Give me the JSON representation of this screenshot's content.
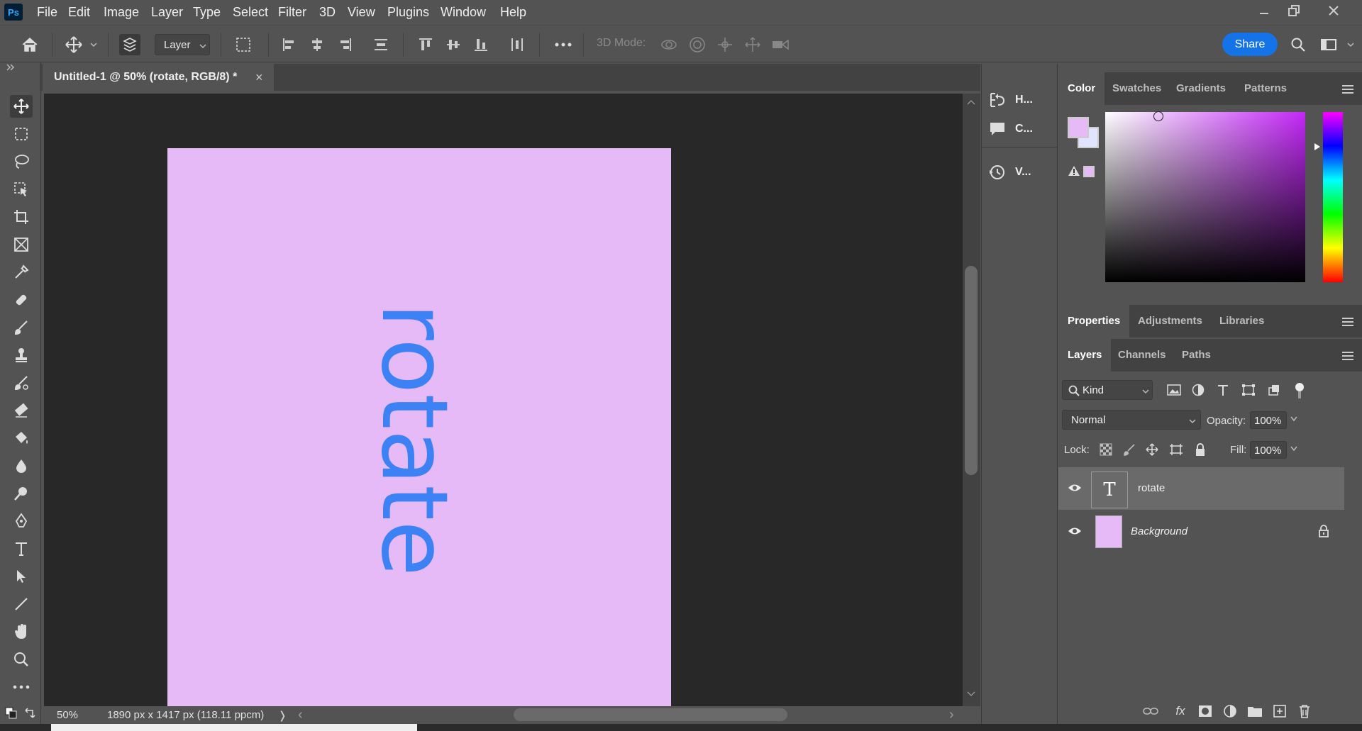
{
  "app": {
    "logo": "Ps"
  },
  "menu": [
    "File",
    "Edit",
    "Image",
    "Layer",
    "Type",
    "Select",
    "Filter",
    "3D",
    "View",
    "Plugins",
    "Window",
    "Help"
  ],
  "options": {
    "layer_select": "Layer",
    "mode_label": "3D Mode:",
    "share_label": "Share"
  },
  "document": {
    "tab_title": "Untitled-1 @ 50% (rotate, RGB/8) *",
    "close_glyph": "×",
    "canvas_text": "rotate",
    "canvas_color": "#e6b9f7",
    "text_color": "#3d82f5"
  },
  "status": {
    "zoom": "50%",
    "info": "1890 px x 1417 px (118.11 ppcm)",
    "arrow": "❭",
    "scroll_left": "‹",
    "scroll_right": "›"
  },
  "mid_panel": [
    {
      "icon": "history-brush-icon",
      "label": "H..."
    },
    {
      "icon": "comment-icon",
      "label": "C..."
    },
    {
      "icon": "history-icon",
      "label": "V..."
    }
  ],
  "color_panel": {
    "tabs": [
      "Color",
      "Swatches",
      "Gradients",
      "Patterns"
    ],
    "foreground": "#e6b9f7",
    "background": "#e0e4ff"
  },
  "properties_panel": {
    "tabs": [
      "Properties",
      "Adjustments",
      "Libraries"
    ]
  },
  "layers_panel": {
    "tabs": [
      "Layers",
      "Channels",
      "Paths"
    ],
    "filter_kind": "Kind",
    "blend_mode": "Normal",
    "opacity_label": "Opacity:",
    "opacity": "100%",
    "lock_label": "Lock:",
    "fill_label": "Fill:",
    "fill": "100%",
    "layers": [
      {
        "name": "rotate",
        "type": "text",
        "thumb_glyph": "T",
        "selected": true
      },
      {
        "name": "Background",
        "type": "pixel",
        "locked": true,
        "thumb_color": "#e6b9f7"
      }
    ]
  },
  "footer": {
    "fx": "fx"
  }
}
